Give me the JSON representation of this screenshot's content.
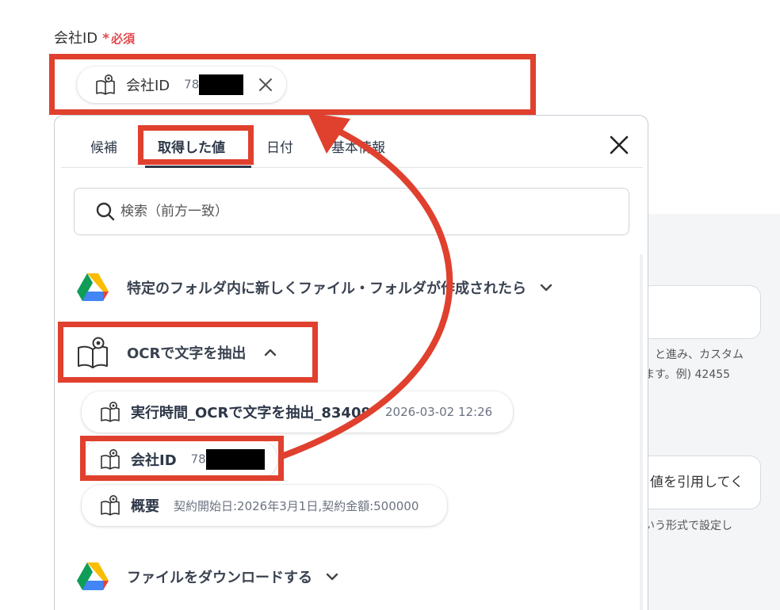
{
  "field": {
    "label": "会社ID",
    "required_star": "*",
    "required_text": "必須"
  },
  "selected_chip": {
    "name": "会社ID",
    "value": "78"
  },
  "tabs": [
    {
      "label": "候補"
    },
    {
      "label": "取得した値"
    },
    {
      "label": "日付"
    },
    {
      "label": "基本情報"
    }
  ],
  "search": {
    "placeholder": "検索（前方一致）"
  },
  "sections": [
    {
      "label": "特定のフォルダ内に新しくファイル・フォルダが作成されたら"
    },
    {
      "label": "OCRで文字を抽出"
    },
    {
      "label": "ファイルをダウンロードする"
    }
  ],
  "ocr_items": [
    {
      "name": "実行時間_OCRで文字を抽出_83409",
      "value": "2026-03-02 12:26"
    },
    {
      "name": "会社ID",
      "value": "78"
    },
    {
      "name": "概要",
      "value": "契約開始日:2026年3月1日,契約金額:500000"
    }
  ],
  "background_form": {
    "hint1_line1": "」と進み、カスタム",
    "hint1_line2": "ます。例) 42455",
    "input2_text": "値を引用してく",
    "hint2": "いう形式で設定し"
  },
  "colors": {
    "annotation": "#e0402e",
    "required": "#e5484d"
  },
  "icons": {
    "book": "book-eye-icon",
    "drive": "google-drive-icon",
    "search": "search-icon",
    "close": "close-icon",
    "chevron_down": "chevron-down-icon",
    "chevron_up": "chevron-up-icon"
  }
}
